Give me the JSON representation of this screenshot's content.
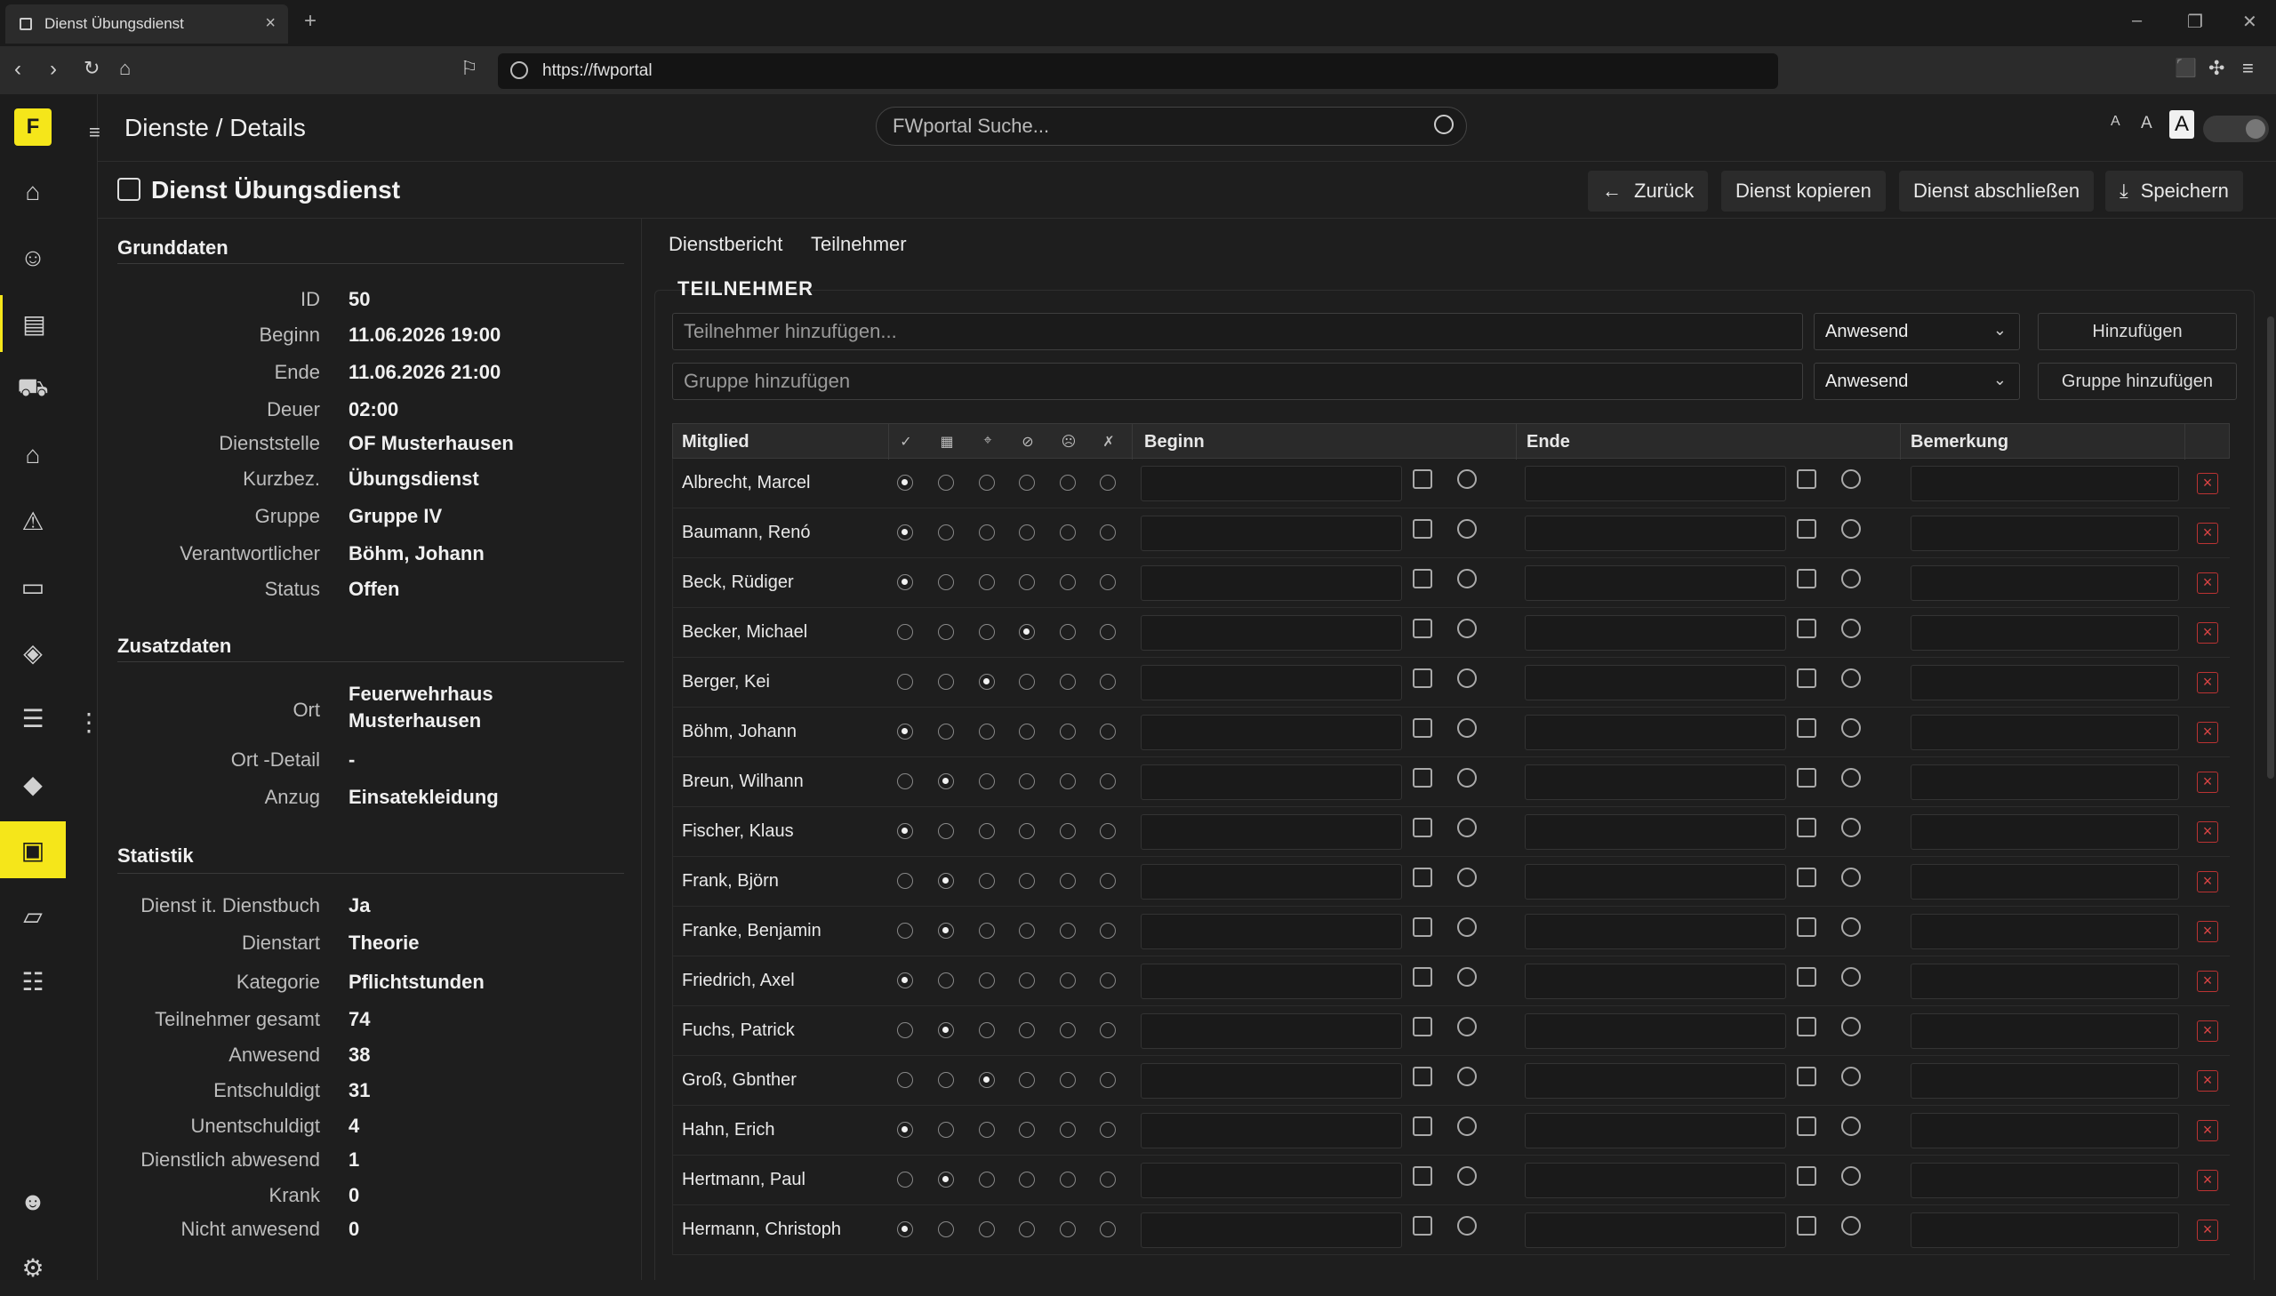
{
  "browser": {
    "tab_title": "Dienst Übungsdienst",
    "url": "https://fwportal"
  },
  "header": {
    "title": "Dienste / Details",
    "search_placeholder": "FWportal Suche...",
    "font_sizes": [
      "A",
      "A",
      "A"
    ]
  },
  "page": {
    "title": "Dienst Übungsdienst",
    "actions": {
      "back": "Zurück",
      "copy": "Dienst kopieren",
      "close": "Dienst abschließen",
      "save": "Speichern"
    }
  },
  "grunddaten": {
    "title": "Grunddaten",
    "items": [
      {
        "label": "ID",
        "value": "50"
      },
      {
        "label": "Beginn",
        "value": "11.06.2026 19:00"
      },
      {
        "label": "Ende",
        "value": "11.06.2026 21:00"
      },
      {
        "label": "Deuer",
        "value": "02:00"
      },
      {
        "label": "Dienststelle",
        "value": "OF Musterhausen"
      },
      {
        "label": "Kurzbez.",
        "value": "Übungsdienst"
      },
      {
        "label": "Gruppe",
        "value": "Gruppe IV"
      },
      {
        "label": "Verantwortlicher",
        "value": "Böhm, Johann"
      },
      {
        "label": "Status",
        "value": "Offen"
      }
    ]
  },
  "zusatzdaten": {
    "title": "Zusatzdaten",
    "ort_label": "Ort",
    "ort_line1": "Feuerwehrhaus",
    "ort_line2": "Musterhausen",
    "ort_detail_label": "Ort -Detail",
    "ort_detail_value": "-",
    "anzug_label": "Anzug",
    "anzug_value": "Einsatekleidung"
  },
  "statistik": {
    "title": "Statistik",
    "items": [
      {
        "label": "Dienst it. Dienstbuch",
        "value": "Ja"
      },
      {
        "label": "Dienstart",
        "value": "Theorie"
      },
      {
        "label": "Kategorie",
        "value": "Pflichtstunden"
      },
      {
        "label": "Teilnehmer gesamt",
        "value": "74"
      },
      {
        "label": "Anwesend",
        "value": "38"
      },
      {
        "label": "Entschuldigt",
        "value": "31"
      },
      {
        "label": "Unentschuldigt",
        "value": "4"
      },
      {
        "label": "Dienstlich abwesend",
        "value": "1"
      },
      {
        "label": "Krank",
        "value": "0"
      },
      {
        "label": "Nicht anwesend",
        "value": "0"
      }
    ]
  },
  "subtabs": [
    "Dienstbericht",
    "Teilnehmer"
  ],
  "teilnehmer": {
    "title": "TEILNEHMER",
    "add_placeholder": "Teilnehmer hinzufügen...",
    "group_placeholder": "Gruppe hinzufügen",
    "select_value_1": "Anwesend",
    "select_value_2": "Anwesend",
    "add_button": "Hinzufügen",
    "group_button": "Gruppe hinzufügen",
    "columns": {
      "member": "Mitglied",
      "begin": "Beginn",
      "end": "Ende",
      "note": "Bemerkung"
    },
    "status_icons": [
      "check-circle-icon",
      "calendar-grid-icon",
      "location-icon",
      "no-camera-icon",
      "sick-face-icon",
      "absent-person-icon"
    ],
    "rows": [
      {
        "name": "Albrecht, Marcel",
        "status": 0
      },
      {
        "name": "Baumann, Renó",
        "status": 0
      },
      {
        "name": "Beck, Rüdiger",
        "status": 0
      },
      {
        "name": "Becker, Michael",
        "status": 3
      },
      {
        "name": "Berger, Kei",
        "status": 2
      },
      {
        "name": "Böhm, Johann",
        "status": 0
      },
      {
        "name": "Breun, Wilhann",
        "status": 1
      },
      {
        "name": "Fischer, Klaus",
        "status": 0
      },
      {
        "name": "Frank, Björn",
        "status": 1
      },
      {
        "name": "Franke, Benjamin",
        "status": 1
      },
      {
        "name": "Friedrich, Axel",
        "status": 0
      },
      {
        "name": "Fuchs, Patrick",
        "status": 1
      },
      {
        "name": "Groß, Gbnther",
        "status": 2
      },
      {
        "name": "Hahn, Erich",
        "status": 0
      },
      {
        "name": "Hertmann, Paul",
        "status": 1
      },
      {
        "name": "Hermann, Christoph",
        "status": 0
      }
    ]
  }
}
